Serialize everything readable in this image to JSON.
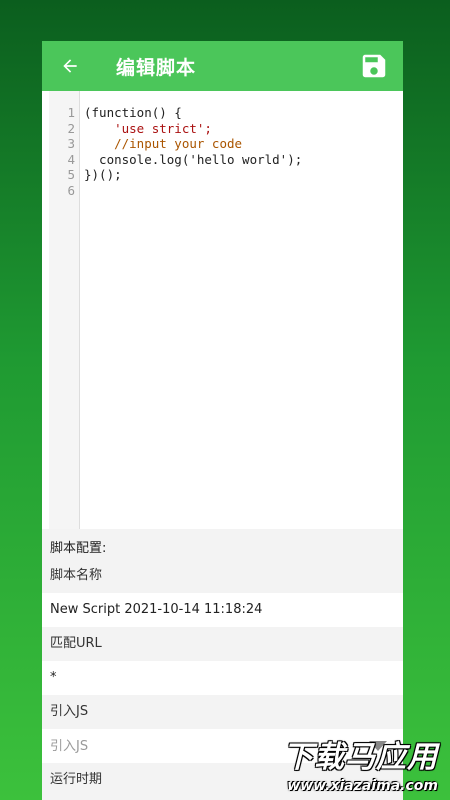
{
  "header": {
    "title": "编辑脚本",
    "back_icon": "arrow-left-icon",
    "save_icon": "floppy-save-icon",
    "color": "#4bc65a"
  },
  "editor": {
    "line_numbers": [
      "1",
      "2",
      "3",
      "4",
      "5",
      "6"
    ],
    "lines": [
      "(function() {",
      "    'use strict';",
      "    //input your code",
      "  console.log('hello world');",
      "})();",
      ""
    ]
  },
  "config": {
    "section_title": "脚本配置:",
    "name_label": "脚本名称",
    "name_value": "New Script 2021-10-14 11:18:24",
    "url_label": "匹配URL",
    "url_value": "*",
    "js_label": "引入JS",
    "js_placeholder": "引入JS",
    "run_label": "运行时期"
  },
  "watermark": {
    "main": "下载马应用",
    "url": "www.xiazaima.com"
  }
}
